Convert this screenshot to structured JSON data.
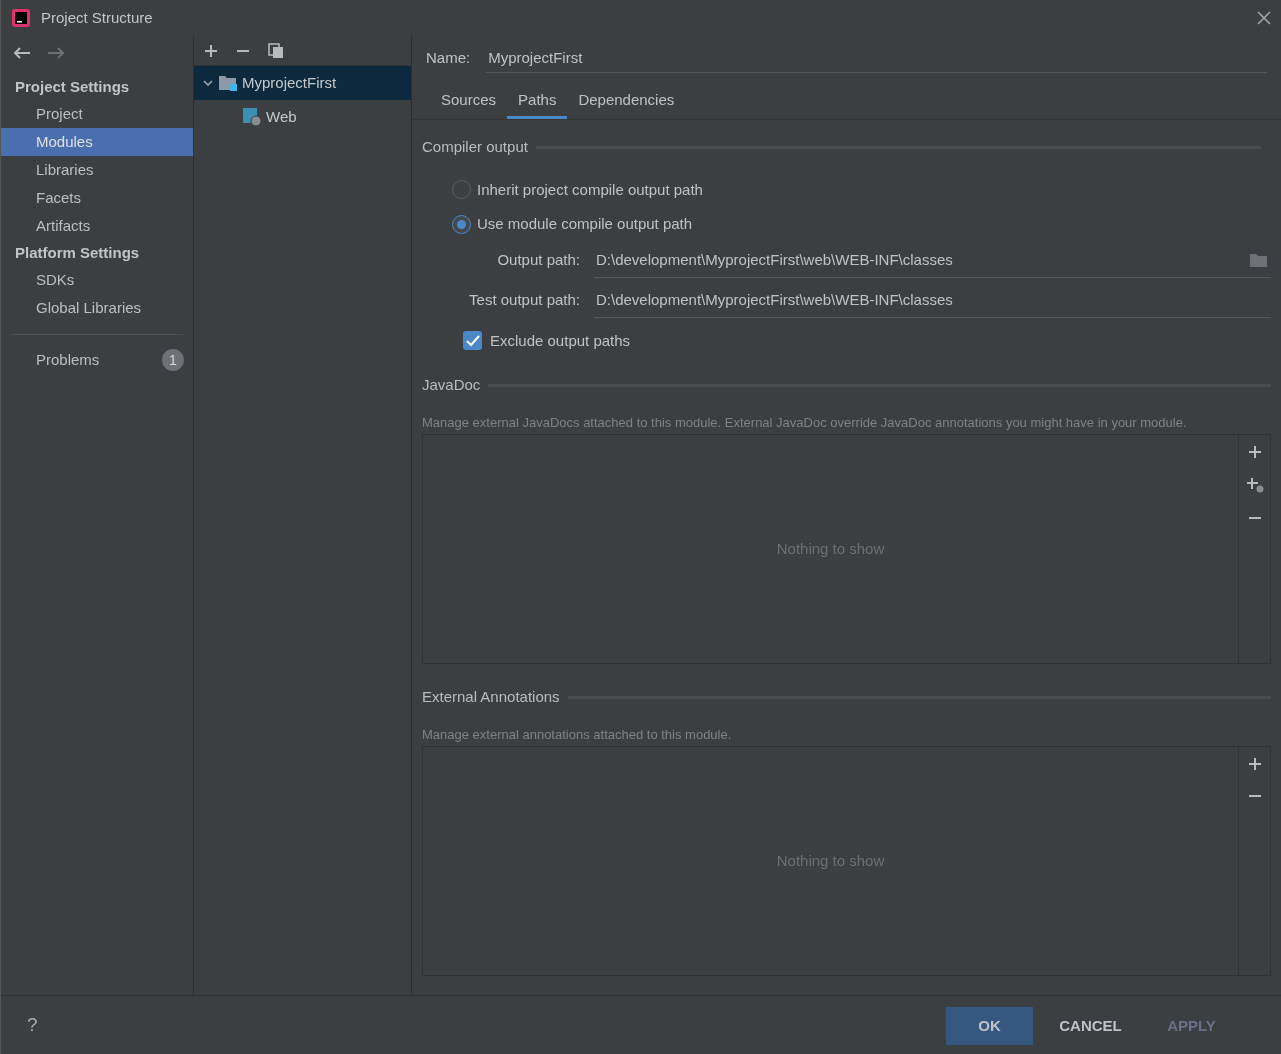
{
  "window": {
    "title": "Project Structure"
  },
  "sidebar": {
    "sections": [
      {
        "title": "Project Settings",
        "items": [
          {
            "label": "Project",
            "selected": false
          },
          {
            "label": "Modules",
            "selected": true
          },
          {
            "label": "Libraries",
            "selected": false
          },
          {
            "label": "Facets",
            "selected": false
          },
          {
            "label": "Artifacts",
            "selected": false
          }
        ]
      },
      {
        "title": "Platform Settings",
        "items": [
          {
            "label": "SDKs",
            "selected": false
          },
          {
            "label": "Global Libraries",
            "selected": false
          }
        ]
      }
    ],
    "problems": {
      "label": "Problems",
      "count": "1"
    }
  },
  "tree": {
    "items": [
      {
        "label": "MyprojectFirst",
        "kind": "module",
        "expanded": true,
        "selected": true,
        "children": [
          {
            "label": "Web",
            "kind": "web",
            "selected": false
          }
        ]
      }
    ]
  },
  "name_field": {
    "label": "Name:",
    "value": "MyprojectFirst"
  },
  "tabs": [
    {
      "label": "Sources",
      "selected": false
    },
    {
      "label": "Paths",
      "selected": true
    },
    {
      "label": "Dependencies",
      "selected": false
    }
  ],
  "compiler_output": {
    "title": "Compiler output",
    "radios": [
      {
        "label": "Inherit project compile output path",
        "selected": false
      },
      {
        "label": "Use module compile output path",
        "selected": true
      }
    ],
    "fields": [
      {
        "label": "Output path:",
        "value": "D:\\development\\MyprojectFirst\\web\\WEB-INF\\classes",
        "browse": true
      },
      {
        "label": "Test output path:",
        "value": "D:\\development\\MyprojectFirst\\web\\WEB-INF\\classes",
        "browse": false
      }
    ],
    "exclude": {
      "label": "Exclude output paths",
      "checked": true
    }
  },
  "javadoc": {
    "title": "JavaDoc",
    "description": "Manage external JavaDocs attached to this module. External JavaDoc override JavaDoc annotations you might have in your module.",
    "empty_text": "Nothing to show",
    "tools": [
      {
        "kind": "add"
      },
      {
        "kind": "add-web"
      },
      {
        "kind": "remove"
      }
    ]
  },
  "annotations": {
    "title": "External Annotations",
    "description": "Manage external annotations attached to this module.",
    "empty_text": "Nothing to show",
    "tools": [
      {
        "kind": "add"
      },
      {
        "kind": "remove"
      }
    ]
  },
  "footer": {
    "help": "?",
    "buttons": [
      {
        "label": "OK",
        "kind": "primary",
        "disabled": false
      },
      {
        "label": "CANCEL",
        "kind": "plain",
        "disabled": false
      },
      {
        "label": "APPLY",
        "kind": "plain",
        "disabled": true
      }
    ]
  }
}
